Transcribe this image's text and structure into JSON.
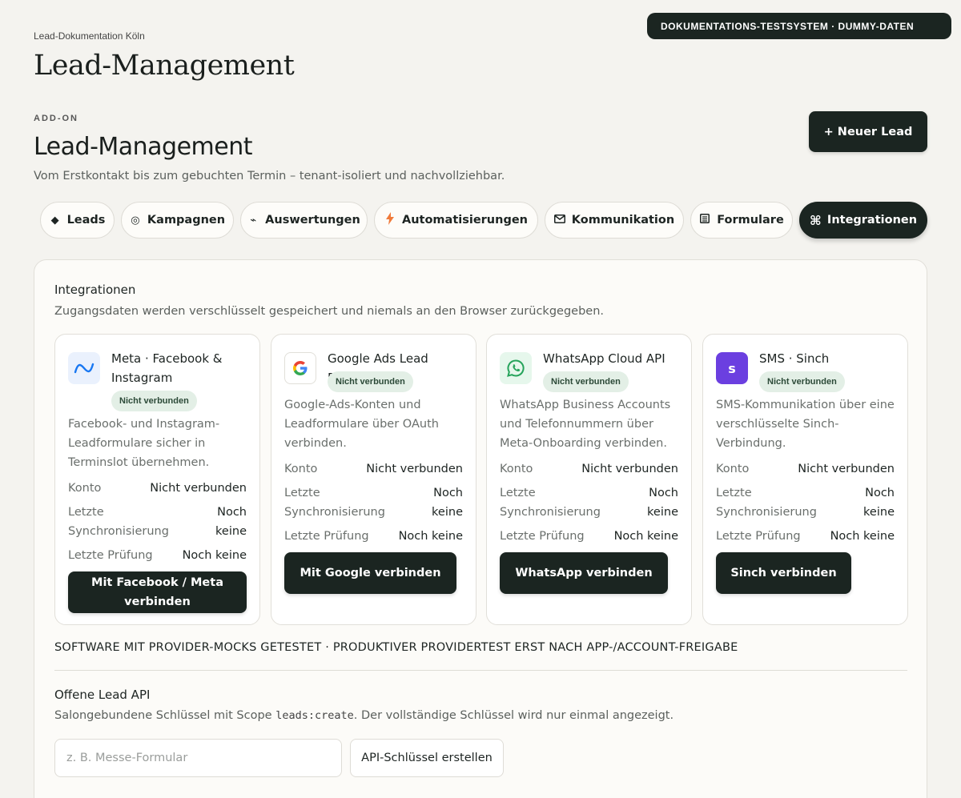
{
  "banner": "DOKUMENTATIONS-TESTSYSTEM · DUMMY-DATEN",
  "breadcrumb": "Lead-Dokumentation Köln",
  "page_title": "Lead-Management",
  "header": {
    "eyebrow": "ADD-ON",
    "title": "Lead-Management",
    "subtitle": "Vom Erstkontakt bis zum gebuchten Termin – tenant-isoliert und nachvollziehbar.",
    "new_lead_label": "+ Neuer Lead"
  },
  "tabs": [
    {
      "label": "Leads",
      "icon": "diamond-icon",
      "active": false
    },
    {
      "label": "Kampagnen",
      "icon": "target-icon",
      "active": false
    },
    {
      "label": "Auswertungen",
      "icon": "trend-icon",
      "active": false
    },
    {
      "label": "Automatisierungen",
      "icon": "lightning-icon",
      "active": false
    },
    {
      "label": "Kommunikation",
      "icon": "envelope-icon",
      "active": false
    },
    {
      "label": "Formulare",
      "icon": "form-icon",
      "active": false
    },
    {
      "label": "Integrationen",
      "icon": "command-icon",
      "active": true
    }
  ],
  "integrations": {
    "title": "Integrationen",
    "description": "Zugangsdaten werden verschlüsselt gespeichert und niemals an den Browser zurückgegeben.",
    "cards": [
      {
        "name": "Meta · Facebook & Instagram",
        "icon": "meta-icon",
        "status": "Nicht verbunden",
        "description": "Facebook- und Instagram-Leadformulare sicher in Terminslot übernehmen.",
        "konto_label": "Konto",
        "konto_value": "Nicht verbunden",
        "sync_label": "Letzte Synchronisierung",
        "sync_value": "Noch keine",
        "check_label": "Letzte Prüfung",
        "check_value": "Noch keine",
        "button": "Mit Facebook / Meta verbinden"
      },
      {
        "name": "Google Ads Lead Forms",
        "icon": "google-icon",
        "status": "Nicht verbunden",
        "description": "Google-Ads-Konten und Leadformulare über OAuth verbinden.",
        "konto_label": "Konto",
        "konto_value": "Nicht verbunden",
        "sync_label": "Letzte Synchronisierung",
        "sync_value": "Noch keine",
        "check_label": "Letzte Prüfung",
        "check_value": "Noch keine",
        "button": "Mit Google verbinden"
      },
      {
        "name": "WhatsApp Cloud API",
        "icon": "whatsapp-icon",
        "status": "Nicht verbunden",
        "description": "WhatsApp Business Accounts und Telefonnummern über Meta-Onboarding verbinden.",
        "konto_label": "Konto",
        "konto_value": "Nicht verbunden",
        "sync_label": "Letzte Synchronisierung",
        "sync_value": "Noch keine",
        "check_label": "Letzte Prüfung",
        "check_value": "Noch keine",
        "button": "WhatsApp verbinden"
      },
      {
        "name": "SMS · Sinch",
        "icon": "sinch-icon",
        "logo_letter": "s",
        "status": "Nicht verbunden",
        "description": "SMS-Kommunikation über eine verschlüsselte Sinch-Verbindung.",
        "konto_label": "Konto",
        "konto_value": "Nicht verbunden",
        "sync_label": "Letzte Synchronisierung",
        "sync_value": "Noch keine",
        "check_label": "Letzte Prüfung",
        "check_value": "Noch keine",
        "button": "Sinch verbinden"
      }
    ],
    "note": "SOFTWARE MIT PROVIDER-MOCKS GETESTET · PRODUKTIVER PROVIDERTEST ERST NACH APP-/ACCOUNT-FREIGABE"
  },
  "api": {
    "title": "Offene Lead API",
    "desc_before": "Salongebundene Schlüssel mit Scope ",
    "desc_code": "leads:create",
    "desc_after": ". Der vollständige Schlüssel wird nur einmal angezeigt.",
    "input_placeholder": "z. B. Messe-Formular",
    "create_button": "API-Schlüssel erstellen"
  },
  "colors": {
    "dark": "#1b2521",
    "badge_bg": "#e3efe6",
    "meta_blue": "#1877f2",
    "whatsapp_green": "#25d366",
    "sinch_purple": "#6b3fe0"
  }
}
